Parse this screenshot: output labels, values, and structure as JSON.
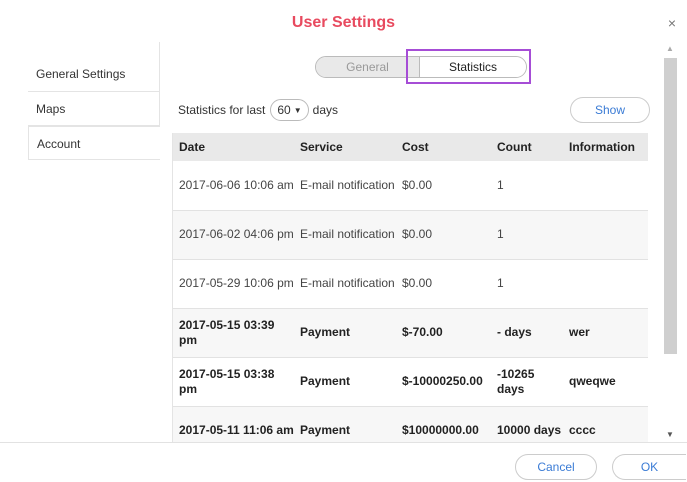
{
  "dialog": {
    "title": "User Settings",
    "close_glyph": "×"
  },
  "sidebar": {
    "items": [
      {
        "label": "General Settings"
      },
      {
        "label": "Maps"
      },
      {
        "label": "Account"
      }
    ]
  },
  "tabs": {
    "general": "General",
    "statistics": "Statistics"
  },
  "filter": {
    "prefix": "Statistics for last",
    "days_value": "60",
    "suffix": "days"
  },
  "show_label": "Show",
  "table": {
    "headers": [
      "Date",
      "Service",
      "Cost",
      "Count",
      "Information"
    ],
    "rows": [
      {
        "date": "2017-06-06 10:06 am",
        "service": "E-mail notification",
        "cost": "$0.00",
        "count": "1",
        "info": ""
      },
      {
        "date": "2017-06-02 04:06 pm",
        "service": "E-mail notification",
        "cost": "$0.00",
        "count": "1",
        "info": ""
      },
      {
        "date": "2017-05-29 10:06 pm",
        "service": "E-mail notification",
        "cost": "$0.00",
        "count": "1",
        "info": ""
      },
      {
        "date": "2017-05-15 03:39 pm",
        "service": "Payment",
        "cost": "$-70.00",
        "count": "- days",
        "info": "wer"
      },
      {
        "date": "2017-05-15 03:38 pm",
        "service": "Payment",
        "cost": "$-10000250.00",
        "count": "-10265 days",
        "info": "qweqwe"
      },
      {
        "date": "2017-05-11 11:06 am",
        "service": "Payment",
        "cost": "$10000000.00",
        "count": "10000 days",
        "info": "cccc"
      }
    ]
  },
  "footer": {
    "cancel": "Cancel",
    "ok": "OK"
  },
  "colors": {
    "title": "#e84a5f",
    "link": "#3a7bd5",
    "highlight": "#a64dd6"
  },
  "icons": {
    "close": "close-icon",
    "scroll_up": "scroll-up-icon",
    "scroll_down": "scroll-down-icon",
    "dropdown": "chevron-down-icon"
  }
}
